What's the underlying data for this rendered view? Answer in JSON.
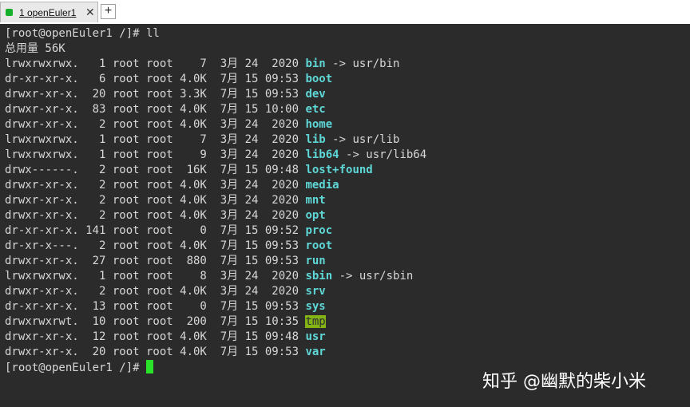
{
  "tabbar": {
    "tab_label": "1 openEuler1",
    "close_glyph": "✕",
    "add_glyph": "+"
  },
  "terminal": {
    "lines": [
      {
        "text": "[root@openEuler1 /]# ll"
      },
      {
        "text": "总用量 56K"
      },
      {
        "prefix": "lrwxrwxrwx.   1 root root    7  3月 24  2020 ",
        "name": "bin",
        "target": " -> usr/bin",
        "style": "link"
      },
      {
        "prefix": "dr-xr-xr-x.   6 root root 4.0K  7月 15 09:53 ",
        "name": "boot",
        "style": "dir"
      },
      {
        "prefix": "drwxr-xr-x.  20 root root 3.3K  7月 15 09:53 ",
        "name": "dev",
        "style": "dir"
      },
      {
        "prefix": "drwxr-xr-x.  83 root root 4.0K  7月 15 10:00 ",
        "name": "etc",
        "style": "dir"
      },
      {
        "prefix": "drwxr-xr-x.   2 root root 4.0K  3月 24  2020 ",
        "name": "home",
        "style": "dir"
      },
      {
        "prefix": "lrwxrwxrwx.   1 root root    7  3月 24  2020 ",
        "name": "lib",
        "target": " -> usr/lib",
        "style": "link"
      },
      {
        "prefix": "lrwxrwxrwx.   1 root root    9  3月 24  2020 ",
        "name": "lib64",
        "target": " -> usr/lib64",
        "style": "link"
      },
      {
        "prefix": "drwx------.   2 root root  16K  7月 15 09:48 ",
        "name": "lost+found",
        "style": "dir"
      },
      {
        "prefix": "drwxr-xr-x.   2 root root 4.0K  3月 24  2020 ",
        "name": "media",
        "style": "dir"
      },
      {
        "prefix": "drwxr-xr-x.   2 root root 4.0K  3月 24  2020 ",
        "name": "mnt",
        "style": "dir"
      },
      {
        "prefix": "drwxr-xr-x.   2 root root 4.0K  3月 24  2020 ",
        "name": "opt",
        "style": "dir"
      },
      {
        "prefix": "dr-xr-xr-x. 141 root root    0  7月 15 09:52 ",
        "name": "proc",
        "style": "dir"
      },
      {
        "prefix": "dr-xr-x---.   2 root root 4.0K  7月 15 09:53 ",
        "name": "root",
        "style": "dir"
      },
      {
        "prefix": "drwxr-xr-x.  27 root root  880  7月 15 09:53 ",
        "name": "run",
        "style": "dir"
      },
      {
        "prefix": "lrwxrwxrwx.   1 root root    8  3月 24  2020 ",
        "name": "sbin",
        "target": " -> usr/sbin",
        "style": "link"
      },
      {
        "prefix": "drwxr-xr-x.   2 root root 4.0K  3月 24  2020 ",
        "name": "srv",
        "style": "dir"
      },
      {
        "prefix": "dr-xr-xr-x.  13 root root    0  7月 15 09:53 ",
        "name": "sys",
        "style": "dir"
      },
      {
        "prefix": "drwxrwxrwt.  10 root root  200  7月 15 10:35 ",
        "name": "tmp",
        "style": "tmp"
      },
      {
        "prefix": "drwxr-xr-x.  12 root root 4.0K  7月 15 09:48 ",
        "name": "usr",
        "style": "dir"
      },
      {
        "prefix": "drwxr-xr-x.  20 root root 4.0K  7月 15 09:53 ",
        "name": "var",
        "style": "dir"
      },
      {
        "text": "[root@openEuler1 /]# ",
        "cursor": true
      }
    ]
  },
  "watermark": "知乎 @幽默的柴小米",
  "colors": {
    "background": "#2b2b2b",
    "text": "#d7d7d7",
    "directory": "#5fd7d7",
    "tmp_highlight": "#84b316",
    "cursor": "#2be22b",
    "tab_indicator": "#17b02a"
  },
  "icons": {
    "tab_status": "green-square-icon",
    "close": "close-icon",
    "add": "plus-icon"
  }
}
